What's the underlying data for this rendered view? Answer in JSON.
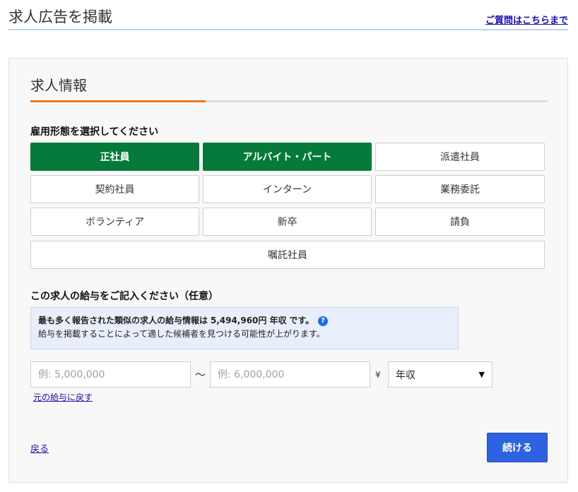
{
  "header": {
    "title": "求人広告を掲載",
    "help_link": "ご質問はこちらまで"
  },
  "section": {
    "title": "求人情報"
  },
  "employment": {
    "label": "雇用形態を選択してください",
    "options": [
      {
        "label": "正社員",
        "selected": true
      },
      {
        "label": "アルバイト・パート",
        "selected": true
      },
      {
        "label": "派遣社員",
        "selected": false
      },
      {
        "label": "契約社員",
        "selected": false
      },
      {
        "label": "インターン",
        "selected": false
      },
      {
        "label": "業務委託",
        "selected": false
      },
      {
        "label": "ボランティア",
        "selected": false
      },
      {
        "label": "新卒",
        "selected": false
      },
      {
        "label": "請負",
        "selected": false
      },
      {
        "label": "嘱託社員",
        "selected": false
      }
    ]
  },
  "salary": {
    "label": "この求人の給与をご記入ください（任意）",
    "info_prefix": "最も多く報告された類似の求人の給与情報は",
    "info_amount": "5,494,960円 年収",
    "info_suffix": "です。",
    "info_line2": "給与を掲載することによって適した候補者を見つける可能性が上がります。",
    "help_icon": "question-icon",
    "min_placeholder": "例: 5,000,000",
    "max_placeholder": "例: 6,000,000",
    "range_separator": "～",
    "currency": "¥",
    "period_value": "年収",
    "reset_link": "元の給与に戻す"
  },
  "footer": {
    "back_link": "戻る",
    "continue_button": "続ける"
  },
  "colors": {
    "selected_green": "#057a3a",
    "accent_orange": "#f0761e",
    "primary_blue": "#2d63e0",
    "link_blue": "#1a0dab"
  }
}
